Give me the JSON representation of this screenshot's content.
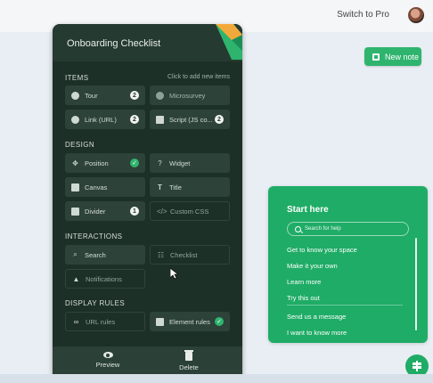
{
  "topbar": {
    "switch_label": "Switch to Pro"
  },
  "new_note": {
    "label": "New note"
  },
  "panel": {
    "title": "Onboarding Checklist",
    "items_heading": "ITEMS",
    "items_hint": "Click to add new items",
    "items": [
      {
        "label": "Tour",
        "badge": "2"
      },
      {
        "label": "Microsurvey"
      },
      {
        "label": "Link (URL)",
        "badge": "2"
      },
      {
        "label": "Script (JS co...",
        "badge": "2"
      }
    ],
    "design_heading": "DESIGN",
    "design": [
      {
        "label": "Position",
        "status": "✓"
      },
      {
        "label": "Widget"
      },
      {
        "label": "Canvas"
      },
      {
        "label": "Title"
      },
      {
        "label": "Divider",
        "badge": "1"
      },
      {
        "label": "Custom CSS"
      }
    ],
    "interactions_heading": "INTERACTIONS",
    "interactions": [
      {
        "label": "Search"
      },
      {
        "label": "Checklist"
      },
      {
        "label": "Notifications"
      }
    ],
    "display_heading": "DISPLAY RULES",
    "display": [
      {
        "label": "URL rules"
      },
      {
        "label": "Element rules",
        "status": "✓"
      }
    ],
    "footer": {
      "preview": "Preview",
      "delete": "Delete"
    }
  },
  "helper": {
    "title": "Start here",
    "search_placeholder": "Search for help",
    "links": [
      "Get to know your space",
      "Make it your own",
      "Learn more",
      "Try this out",
      "Send us a message",
      "I want to know more"
    ]
  },
  "colors": {
    "panel_bg": "#1d3027",
    "accent_green": "#2fb46e",
    "helper_green": "#1fac66"
  }
}
